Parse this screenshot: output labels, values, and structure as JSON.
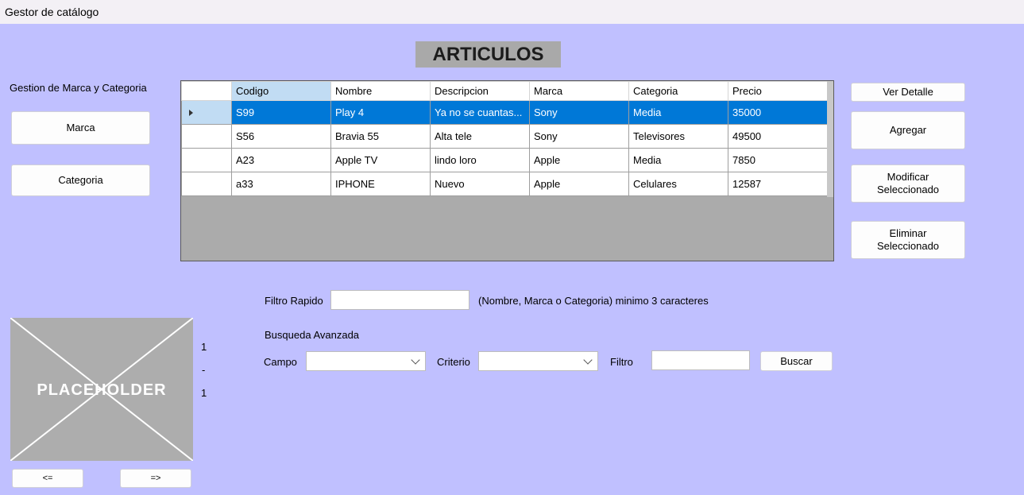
{
  "window": {
    "title": "Gestor de catálogo"
  },
  "heading": "ARTICULOS",
  "left_panel": {
    "section_label": "Gestion de Marca y Categoria",
    "marca_label": "Marca",
    "categoria_label": "Categoria"
  },
  "grid": {
    "columns": [
      "Codigo",
      "Nombre",
      "Descripcion",
      "Marca",
      "Categoria",
      "Precio"
    ],
    "rows": [
      [
        "S99",
        "Play 4",
        "Ya no se cuantas...",
        "Sony",
        "Media",
        "35000"
      ],
      [
        "S56",
        "Bravia 55",
        "Alta tele",
        "Sony",
        "Televisores",
        "49500"
      ],
      [
        "A23",
        "Apple TV",
        "lindo loro",
        "Apple",
        "Media",
        "7850"
      ],
      [
        "a33",
        "IPHONE",
        "Nuevo",
        "Apple",
        "Celulares",
        "12587"
      ]
    ],
    "selected_row": 0
  },
  "right_panel": {
    "ver_detalle": "Ver Detalle",
    "agregar": "Agregar",
    "modificar": "Modificar Seleccionado",
    "eliminar": "Eliminar Seleccionado"
  },
  "filter": {
    "quick_label": "Filtro Rapido",
    "quick_value": "",
    "quick_hint": "(Nombre, Marca o Categoria) minimo 3 caracteres",
    "advanced_label": "Busqueda Avanzada",
    "campo_label": "Campo",
    "campo_value": "",
    "criterio_label": "Criterio",
    "criterio_value": "",
    "filtro_label": "Filtro",
    "filtro_value": "",
    "buscar": "Buscar"
  },
  "image_viewer": {
    "placeholder_text": "PLACEHOLDER",
    "counter_current": "1",
    "counter_sep": "-",
    "counter_total": "1",
    "prev": "<=",
    "next": "=>"
  }
}
